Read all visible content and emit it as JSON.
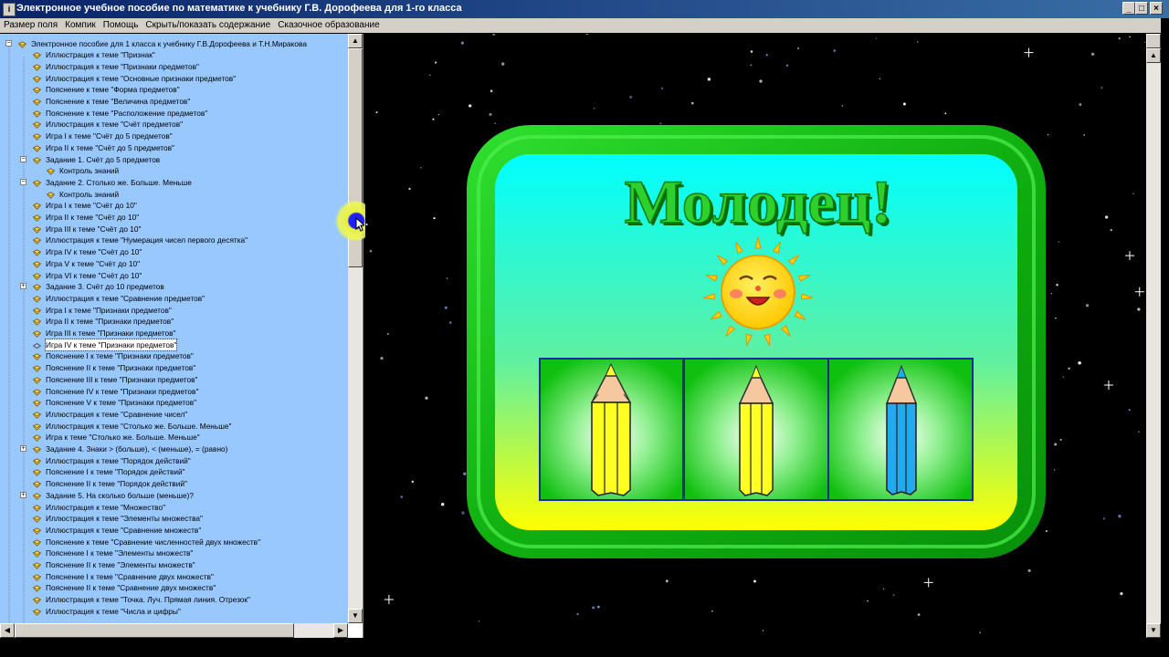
{
  "window": {
    "title": "Электронное учебное пособие по математике к учебнику Г.В. Дорофеева для 1-го класса",
    "buttons": [
      "_",
      "□",
      "×"
    ]
  },
  "menu": [
    "Размер поля",
    "Компик",
    "Помощь",
    "Скрыть/показать содержание",
    "Сказочное образование"
  ],
  "tree": {
    "root": "Электронное пособие для 1 класса к учебнику Г.В.Дорофеева и Т.Н.Миракова",
    "items": [
      {
        "label": "Иллюстрация к теме \"Признак\"",
        "level": 1
      },
      {
        "label": "Иллюстрация к теме \"Признаки предметов\"",
        "level": 1
      },
      {
        "label": "Иллюстрация к теме \"Основные признаки предметов\"",
        "level": 1
      },
      {
        "label": "Пояснение к теме \"Форма предметов\"",
        "level": 1
      },
      {
        "label": "Пояснение к теме \"Величина предметов\"",
        "level": 1
      },
      {
        "label": "Пояснение к теме \"Расположение предметов\"",
        "level": 1
      },
      {
        "label": "Иллюстрация к теме \"Счёт предметов\"",
        "level": 1
      },
      {
        "label": "Игра I к теме \"Счёт до 5 предметов\"",
        "level": 1
      },
      {
        "label": "Игра II к теме \"Счёт до 5 предметов\"",
        "level": 1
      },
      {
        "label": "Задание 1. Счёт до 5 предметов",
        "level": 1,
        "expander": "-"
      },
      {
        "label": "Контроль знаний",
        "level": 2
      },
      {
        "label": "Задание 2. Столько же. Больше. Меньше",
        "level": 1,
        "expander": "-"
      },
      {
        "label": "Контроль знаний",
        "level": 2
      },
      {
        "label": "Игра I к теме \"Счёт до 10\"",
        "level": 1
      },
      {
        "label": "Игра II к теме \"Счёт до 10\"",
        "level": 1
      },
      {
        "label": "Игра III к теме \"Счёт до 10\"",
        "level": 1
      },
      {
        "label": "Иллюстрация к теме \"Нумерация чисел первого десятка\"",
        "level": 1
      },
      {
        "label": "Игра IV к теме \"Счёт до 10\"",
        "level": 1
      },
      {
        "label": "Игра V к теме \"Счёт до 10\"",
        "level": 1
      },
      {
        "label": "Игра VI к теме \"Счёт до 10\"",
        "level": 1
      },
      {
        "label": "Задание 3. Счёт до 10 предметов",
        "level": 1,
        "expander": "+"
      },
      {
        "label": "Иллюстрация к теме \"Сравнение предметов\"",
        "level": 1
      },
      {
        "label": "Игра I к теме \"Признаки предметов\"",
        "level": 1
      },
      {
        "label": "Игра II к теме \"Признаки предметов\"",
        "level": 1
      },
      {
        "label": "Игра III к теме \"Признаки предметов\"",
        "level": 1
      },
      {
        "label": "Игра IV к теме \"Признаки предметов\"",
        "level": 1,
        "selected": true
      },
      {
        "label": "Пояснение I к теме \"Признаки предметов\"",
        "level": 1
      },
      {
        "label": "Пояснение II к теме \"Признаки предметов\"",
        "level": 1
      },
      {
        "label": "Пояснение III к теме \"Признаки предметов\"",
        "level": 1
      },
      {
        "label": "Пояснение IV к теме \"Признаки предметов\"",
        "level": 1
      },
      {
        "label": "Пояснение V к теме \"Признаки предметов\"",
        "level": 1
      },
      {
        "label": "Иллюстрация к теме \"Сравнение чисел\"",
        "level": 1
      },
      {
        "label": "Иллюстрация к теме \"Столько же. Больше. Меньше\"",
        "level": 1
      },
      {
        "label": "Игра к теме \"Столько же. Больше. Меньше\"",
        "level": 1
      },
      {
        "label": "Задание 4. Знаки > (больше), < (меньше), = (равно)",
        "level": 1,
        "expander": "+"
      },
      {
        "label": "Иллюстрация к теме \"Порядок действий\"",
        "level": 1
      },
      {
        "label": "Пояснение I к теме \"Порядок действий\"",
        "level": 1
      },
      {
        "label": "Пояснение II к теме \"Порядок действий\"",
        "level": 1
      },
      {
        "label": "Задание 5. На сколько больше (меньше)?",
        "level": 1,
        "expander": "+"
      },
      {
        "label": "Иллюстрация к теме \"Множество\"",
        "level": 1
      },
      {
        "label": "Иллюстрация к теме \"Элементы множества\"",
        "level": 1
      },
      {
        "label": "Иллюстрация к теме \"Сравнение множеств\"",
        "level": 1
      },
      {
        "label": "Пояснение к теме \"Сравнение численностей двух множеств\"",
        "level": 1
      },
      {
        "label": "Пояснение I к теме \"Элементы множеств\"",
        "level": 1
      },
      {
        "label": "Пояснение II к теме \"Элементы множеств\"",
        "level": 1
      },
      {
        "label": "Пояснение I к теме \"Сравнение двух множеств\"",
        "level": 1
      },
      {
        "label": "Пояснение II к теме \"Сравнение двух множеств\"",
        "level": 1
      },
      {
        "label": "Иллюстрация к теме \"Точка. Луч. Прямая линия. Отрезок\"",
        "level": 1
      },
      {
        "label": "Иллюстрация к теме \"Числа и цифры\"",
        "level": 1
      }
    ]
  },
  "card": {
    "headline": "Молодец!",
    "pencils": [
      {
        "color": "yellow"
      },
      {
        "color": "yellow"
      },
      {
        "color": "blue"
      }
    ],
    "colors": {
      "frame": "#18c018",
      "top_gradient": "#00ffff",
      "bottom_gradient": "#ffff00",
      "headline": "#22c022",
      "sun": "#ffd800",
      "pencil_yellow": "#ffff22",
      "pencil_blue": "#22aaee",
      "cell_border": "#1a2a9a"
    }
  },
  "icons": {
    "tree_item": "lesson-icon",
    "tree_item_open": "open-lesson-icon",
    "tree_root": "book-icon"
  }
}
